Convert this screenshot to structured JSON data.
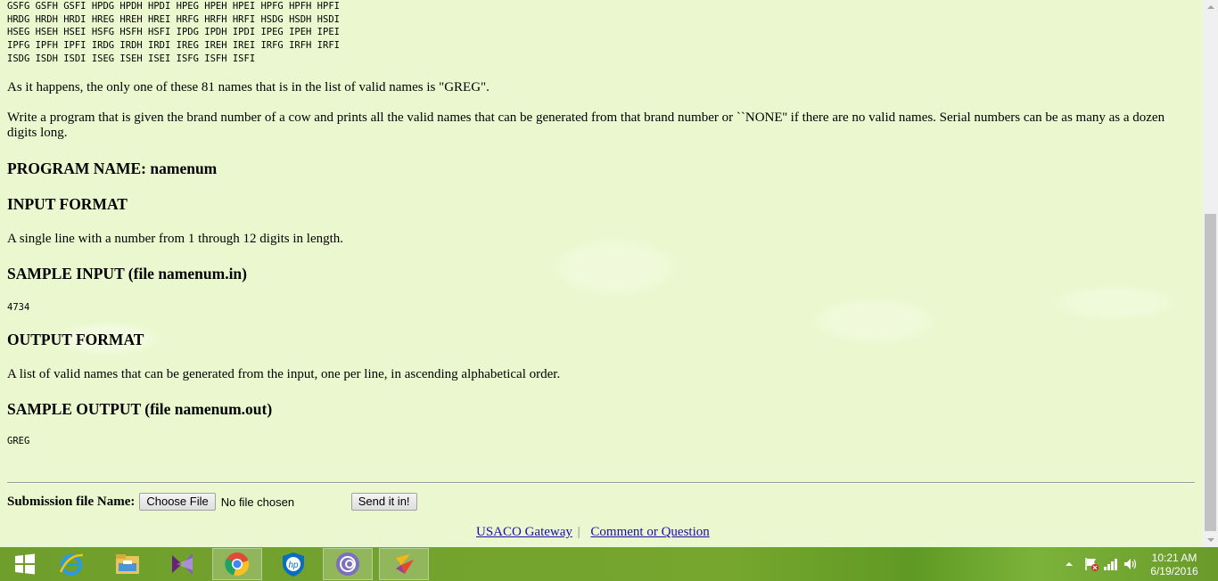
{
  "permutations": [
    "GSFG GSFH GSFI HPDG HPDH HPDI HPEG HPEH HPEI HPFG HPFH HPFI",
    "HRDG HRDH HRDI HREG HREH HREI HRFG HRFH HRFI HSDG HSDH HSDI",
    "HSEG HSEH HSEI HSFG HSFH HSFI IPDG IPDH IPDI IPEG IPEH IPEI",
    "IPFG IPFH IPFI IRDG IRDH IRDI IREG IREH IREI IRFG IRFH IRFI",
    "ISDG ISDH ISDI ISEG ISEH ISEI ISFG ISFH ISFI"
  ],
  "para_greg": "As it happens, the only one of these 81 names that is in the list of valid names is \"GREG\".",
  "para_task": "Write a program that is given the brand number of a cow and prints all the valid names that can be generated from that brand number or ``NONE'' if there are no valid names. Serial numbers can be as many as a dozen digits long.",
  "program_name": "PROGRAM NAME: namenum",
  "input_format_heading": "INPUT FORMAT",
  "input_format_text": "A single line with a number from 1 through 12 digits in length.",
  "sample_input_heading": "SAMPLE INPUT (file namenum.in)",
  "sample_input": "4734",
  "output_format_heading": "OUTPUT FORMAT",
  "output_format_text": "A list of valid names that can be generated from the input, one per line, in ascending alphabetical order.",
  "sample_output_heading": "SAMPLE OUTPUT (file namenum.out)",
  "sample_output": "GREG",
  "submission": {
    "label": "Submission file Name:",
    "choose_file": "Choose File",
    "no_file": "No file chosen",
    "send": "Send it in!"
  },
  "footer": {
    "gateway": "USACO Gateway",
    "separator": "|",
    "comment": "Comment or Question"
  },
  "taskbar": {
    "apps": [
      "start-icon",
      "internet-explorer-icon",
      "file-explorer-icon",
      "visual-studio-icon",
      "chrome-icon",
      "hp-icon",
      "app-icon",
      "app2-icon"
    ],
    "active_app": "chrome-icon"
  },
  "clock": {
    "time": "10:21 AM",
    "date": "6/19/2016"
  }
}
